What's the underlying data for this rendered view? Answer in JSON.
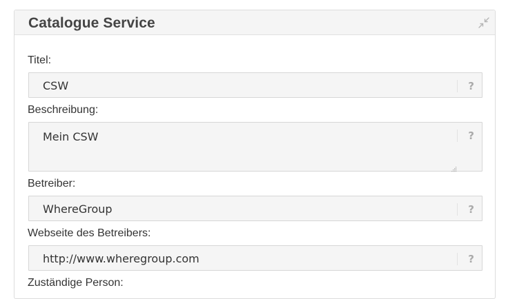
{
  "panel": {
    "title": "Catalogue Service",
    "collapse_icon": "collapse-arrows-icon"
  },
  "fields": [
    {
      "label": "Titel:",
      "value": "CSW",
      "help": "?"
    },
    {
      "label": "Beschreibung:",
      "value": "Mein CSW",
      "help": "?"
    },
    {
      "label": "Betreiber:",
      "value": "WhereGroup",
      "help": "?"
    },
    {
      "label": "Webseite des Betreibers:",
      "value": "http://www.wheregroup.com",
      "help": "?"
    },
    {
      "label": "Zuständige Person:"
    }
  ],
  "colors": {
    "panel_header_bg": "#f5f5f5",
    "input_bg": "#f5f5f5",
    "border": "#d6d6d6",
    "help_icon": "#aaaaaa"
  }
}
